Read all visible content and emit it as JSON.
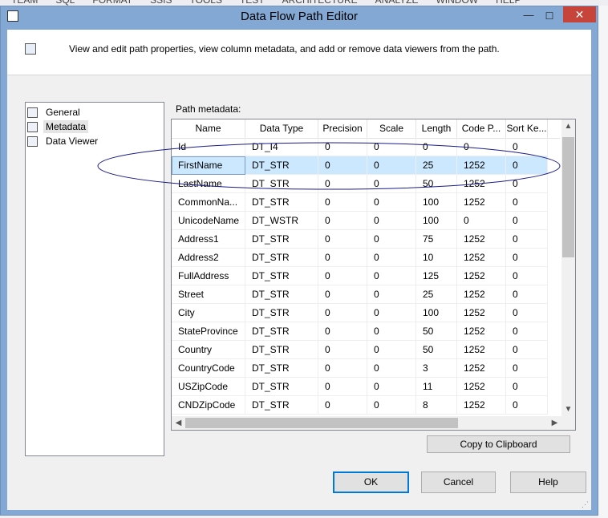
{
  "menubar": [
    "TEAM",
    "SQL",
    "FORMAT",
    "SSIS",
    "TOOLS",
    "TEST",
    "ARCHITECTURE",
    "ANALYZE",
    "WINDOW",
    "HELP"
  ],
  "window": {
    "title": "Data Flow Path Editor",
    "minimize_glyph": "—",
    "maximize_glyph": "☐",
    "close_glyph": "✕"
  },
  "header": {
    "text": "View and edit path properties, view column metadata, and add or remove data viewers from the path."
  },
  "nav": {
    "items": [
      {
        "label": "General",
        "selected": false
      },
      {
        "label": "Metadata",
        "selected": true
      },
      {
        "label": "Data Viewer",
        "selected": false
      }
    ]
  },
  "metadata": {
    "label": "Path metadata:",
    "columns": [
      "Name",
      "Data Type",
      "Precision",
      "Scale",
      "Length",
      "Code P...",
      "Sort Ke..."
    ],
    "rows": [
      [
        "Id",
        "DT_I4",
        "0",
        "0",
        "0",
        "0",
        "0"
      ],
      [
        "FirstName",
        "DT_STR",
        "0",
        "0",
        "25",
        "1252",
        "0"
      ],
      [
        "LastName",
        "DT_STR",
        "0",
        "0",
        "50",
        "1252",
        "0"
      ],
      [
        "CommonNa...",
        "DT_STR",
        "0",
        "0",
        "100",
        "1252",
        "0"
      ],
      [
        "UnicodeName",
        "DT_WSTR",
        "0",
        "0",
        "100",
        "0",
        "0"
      ],
      [
        "Address1",
        "DT_STR",
        "0",
        "0",
        "75",
        "1252",
        "0"
      ],
      [
        "Address2",
        "DT_STR",
        "0",
        "0",
        "10",
        "1252",
        "0"
      ],
      [
        "FullAddress",
        "DT_STR",
        "0",
        "0",
        "125",
        "1252",
        "0"
      ],
      [
        "Street",
        "DT_STR",
        "0",
        "0",
        "25",
        "1252",
        "0"
      ],
      [
        "City",
        "DT_STR",
        "0",
        "0",
        "100",
        "1252",
        "0"
      ],
      [
        "StateProvince",
        "DT_STR",
        "0",
        "0",
        "50",
        "1252",
        "0"
      ],
      [
        "Country",
        "DT_STR",
        "0",
        "0",
        "50",
        "1252",
        "0"
      ],
      [
        "CountryCode",
        "DT_STR",
        "0",
        "0",
        "3",
        "1252",
        "0"
      ],
      [
        "USZipCode",
        "DT_STR",
        "0",
        "0",
        "11",
        "1252",
        "0"
      ],
      [
        "CNDZipCode",
        "DT_STR",
        "0",
        "0",
        "8",
        "1252",
        "0"
      ]
    ],
    "selected_row": 1,
    "scroll_up_glyph": "▲",
    "scroll_down_glyph": "▼",
    "scroll_left_glyph": "◀",
    "scroll_right_glyph": "▶"
  },
  "buttons": {
    "copy": "Copy to Clipboard",
    "ok": "OK",
    "cancel": "Cancel",
    "help": "Help"
  },
  "annotation_color": "#1a1a8c"
}
